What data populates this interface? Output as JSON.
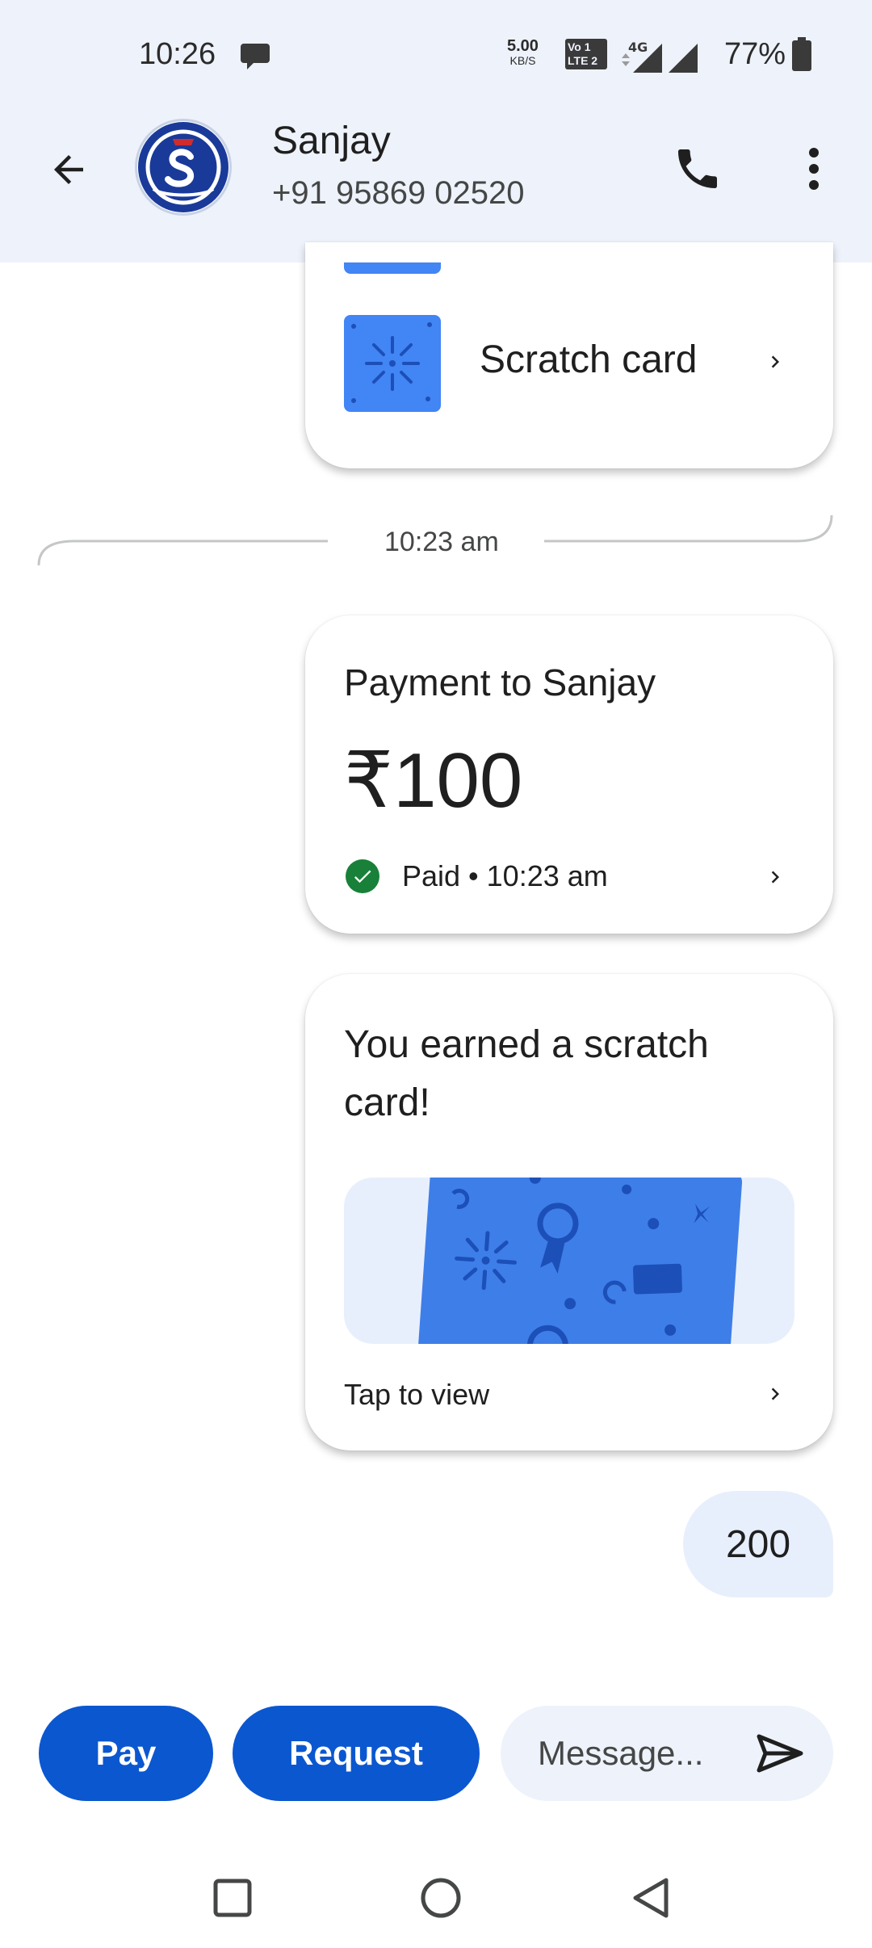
{
  "status_bar": {
    "time": "10:26",
    "speed_value": "5.00",
    "speed_unit": "KB/S",
    "volte_line1": "Vo 1",
    "volte_line2": "LTE 2",
    "network": "4G",
    "battery_percent": "77%",
    "icons": [
      "chat-bubble-icon",
      "signal-icon",
      "battery-icon"
    ]
  },
  "header": {
    "contact_name": "Sanjay",
    "contact_phone": "+91 95869 02520",
    "icons": [
      "back-arrow-icon",
      "phone-icon",
      "more-vert-icon"
    ]
  },
  "messages": {
    "scratch_card_label": "Scratch card",
    "divider_time": "10:23 am",
    "payment": {
      "title": "Payment to Sanjay",
      "amount": "₹100",
      "status": "Paid • 10:23 am",
      "status_color": "#188038"
    },
    "earned": {
      "title": "You earned a scratch card!",
      "action": "Tap to view"
    },
    "bubble_text": "200"
  },
  "bottom_bar": {
    "pay_label": "Pay",
    "request_label": "Request",
    "message_placeholder": "Message...",
    "accent_color": "#0b57d0"
  },
  "nav": {
    "icons": [
      "recents-square-icon",
      "home-circle-icon",
      "back-triangle-icon"
    ]
  }
}
